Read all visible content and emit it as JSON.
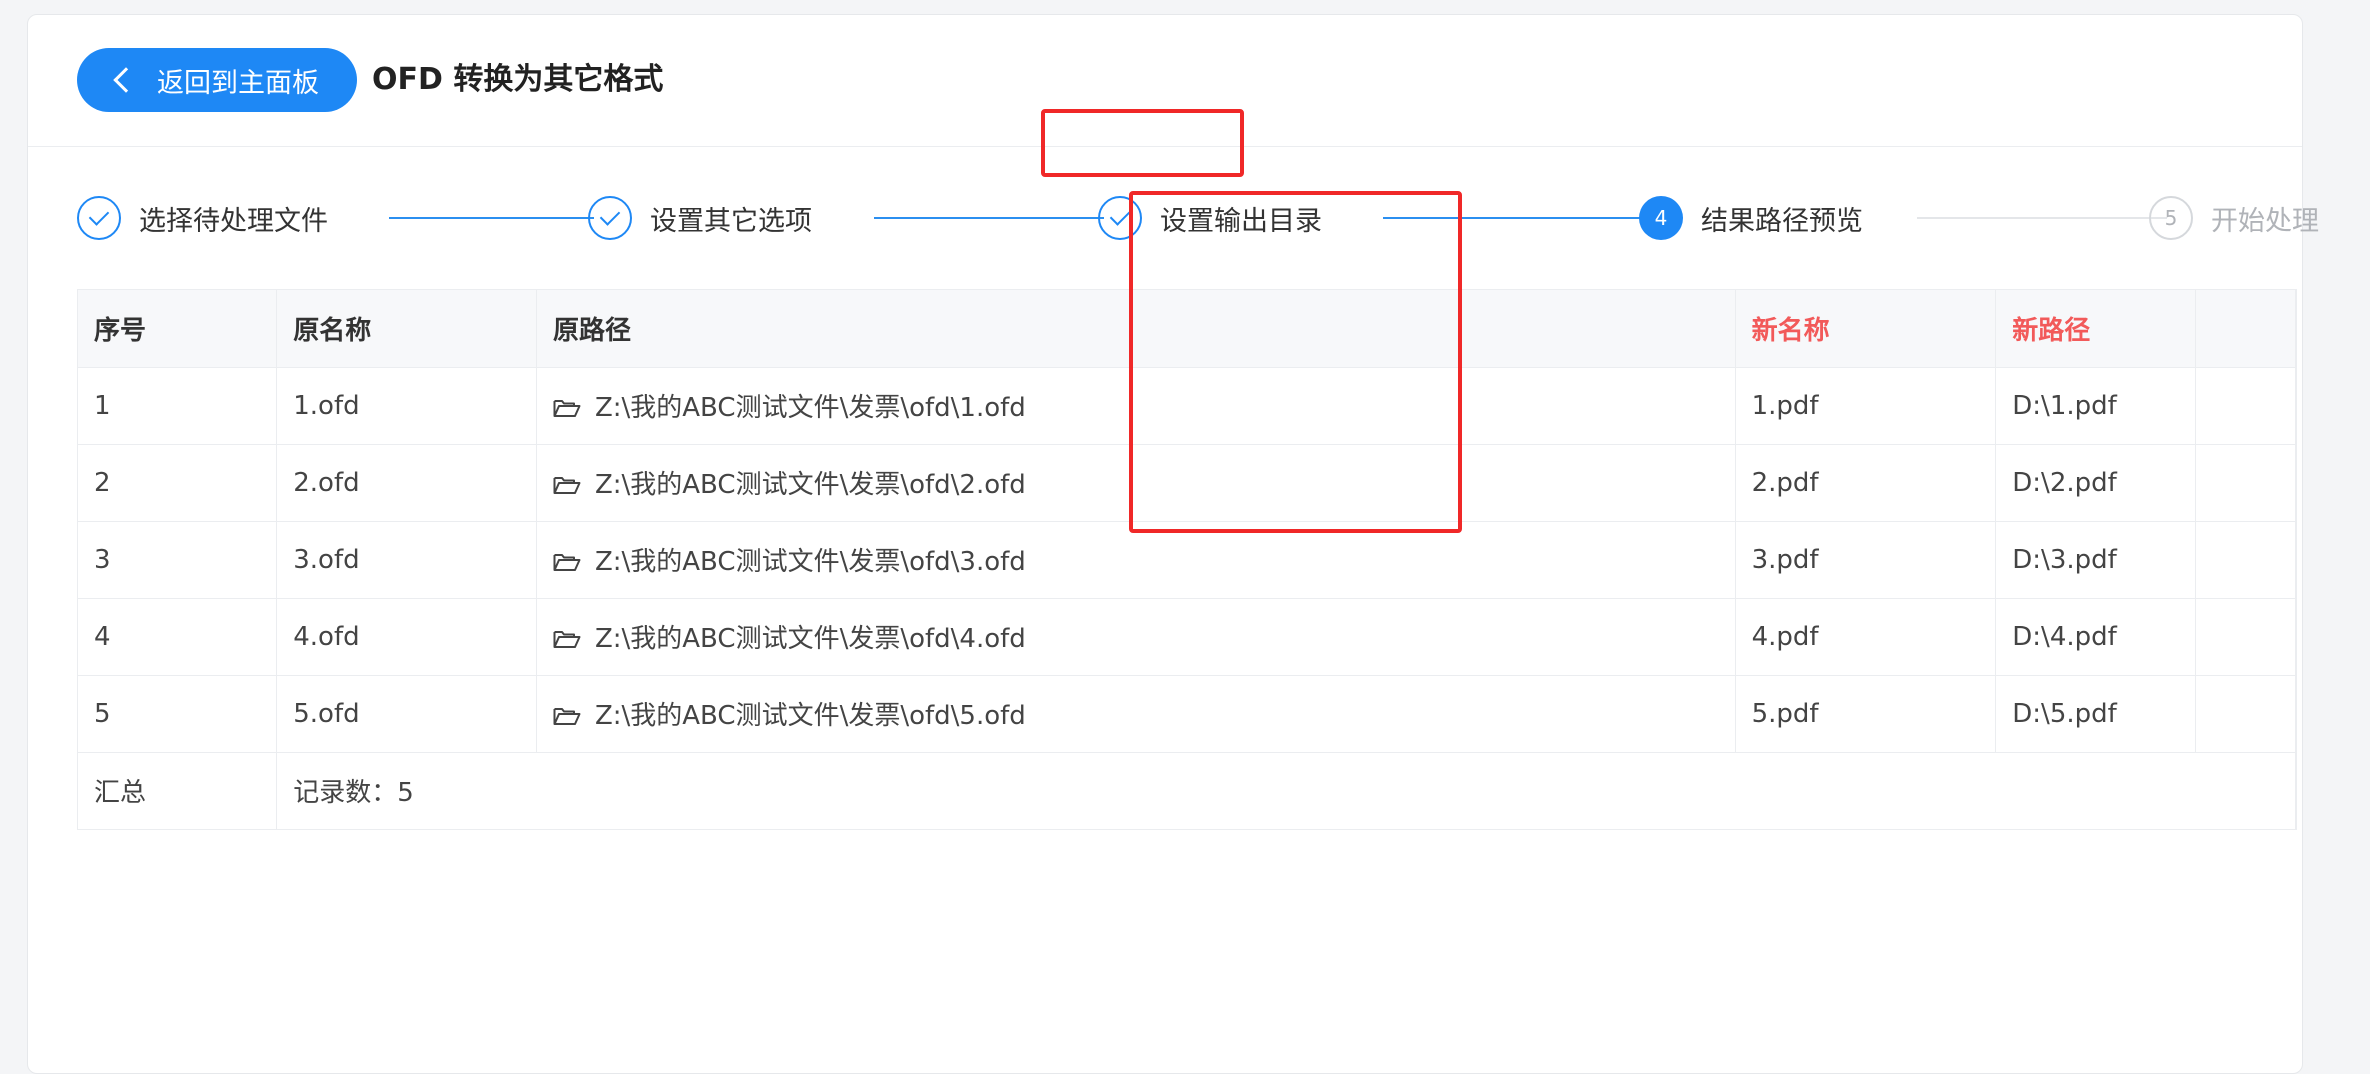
{
  "header": {
    "back_label": "返回到主面板",
    "title": "OFD 转换为其它格式"
  },
  "steps": [
    {
      "label": "选择待处理文件",
      "state": "done"
    },
    {
      "label": "设置其它选项",
      "state": "done"
    },
    {
      "label": "设置输出目录",
      "state": "done"
    },
    {
      "label": "结果路径预览",
      "state": "active",
      "number": "4"
    },
    {
      "label": "开始处理",
      "state": "pending",
      "number": "5"
    }
  ],
  "table": {
    "columns": [
      "序号",
      "原名称",
      "原路径",
      "新名称",
      "新路径"
    ],
    "rows": [
      {
        "index": "1",
        "orig_name": "1.ofd",
        "orig_path": "Z:\\我的ABC测试文件\\发票\\ofd\\1.ofd",
        "new_name": "1.pdf",
        "new_path": "D:\\1.pdf"
      },
      {
        "index": "2",
        "orig_name": "2.ofd",
        "orig_path": "Z:\\我的ABC测试文件\\发票\\ofd\\2.ofd",
        "new_name": "2.pdf",
        "new_path": "D:\\2.pdf"
      },
      {
        "index": "3",
        "orig_name": "3.ofd",
        "orig_path": "Z:\\我的ABC测试文件\\发票\\ofd\\3.ofd",
        "new_name": "3.pdf",
        "new_path": "D:\\3.pdf"
      },
      {
        "index": "4",
        "orig_name": "4.ofd",
        "orig_path": "Z:\\我的ABC测试文件\\发票\\ofd\\4.ofd",
        "new_name": "4.pdf",
        "new_path": "D:\\4.pdf"
      },
      {
        "index": "5",
        "orig_name": "5.ofd",
        "orig_path": "Z:\\我的ABC测试文件\\发票\\ofd\\5.ofd",
        "new_name": "5.pdf",
        "new_path": "D:\\5.pdf"
      }
    ],
    "summary_label": "汇总",
    "summary_value": "记录数：5"
  },
  "colors": {
    "accent": "#1e88f5",
    "highlight": "#f02828",
    "new_column_header": "#f25a5a"
  }
}
